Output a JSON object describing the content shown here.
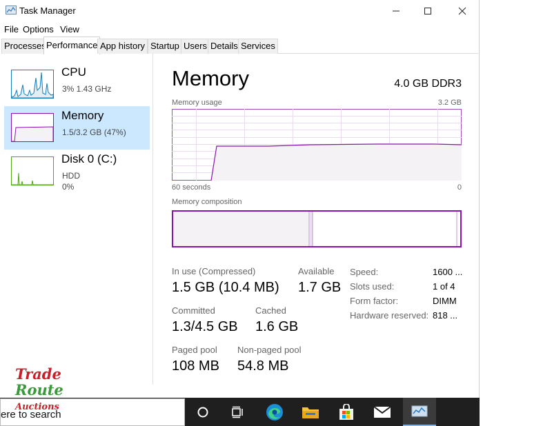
{
  "window": {
    "title": "Task Manager"
  },
  "menu": {
    "file": "File",
    "options": "Options",
    "view": "View"
  },
  "tabs": [
    {
      "label": "Processes"
    },
    {
      "label": "Performance"
    },
    {
      "label": "App history"
    },
    {
      "label": "Startup"
    },
    {
      "label": "Users"
    },
    {
      "label": "Details"
    },
    {
      "label": "Services"
    }
  ],
  "sidebar": {
    "items": [
      {
        "title": "CPU",
        "line1": "3%  1.43 GHz"
      },
      {
        "title": "Memory",
        "line1": "1.5/3.2 GB (47%)"
      },
      {
        "title": "Disk 0 (C:)",
        "line1": "HDD",
        "line2": "0%"
      }
    ]
  },
  "main": {
    "title": "Memory",
    "spec": "4.0 GB DDR3",
    "usage_label": "Memory usage",
    "usage_max": "3.2 GB",
    "time_left": "60 seconds",
    "time_right": "0",
    "composition_label": "Memory composition"
  },
  "stats": {
    "in_use_label": "In use (Compressed)",
    "in_use_value": "1.5 GB (10.4 MB)",
    "available_label": "Available",
    "available_value": "1.7 GB",
    "committed_label": "Committed",
    "committed_value": "1.3/4.5 GB",
    "cached_label": "Cached",
    "cached_value": "1.6 GB",
    "paged_label": "Paged pool",
    "paged_value": "108 MB",
    "nonpaged_label": "Non-paged pool",
    "nonpaged_value": "54.8 MB"
  },
  "specs": {
    "speed_label": "Speed:",
    "speed_value": "1600 ...",
    "slots_label": "Slots used:",
    "slots_value": "1 of 4",
    "form_label": "Form factor:",
    "form_value": "DIMM",
    "reserved_label": "Hardware reserved:",
    "reserved_value": "818 ..."
  },
  "taskbar": {
    "search_text": "ere to search"
  },
  "watermark": {
    "line1": "Trade",
    "line2": "Route",
    "line3": "Auctions"
  },
  "colors": {
    "memory_accent": "#8b12ae",
    "memory_fill": "#f4f2f4",
    "cpu_accent": "#117dbb",
    "disk_accent": "#4da60c",
    "selected_bg": "#cce8ff",
    "taskbar_bg": "#1f1f1f"
  }
}
